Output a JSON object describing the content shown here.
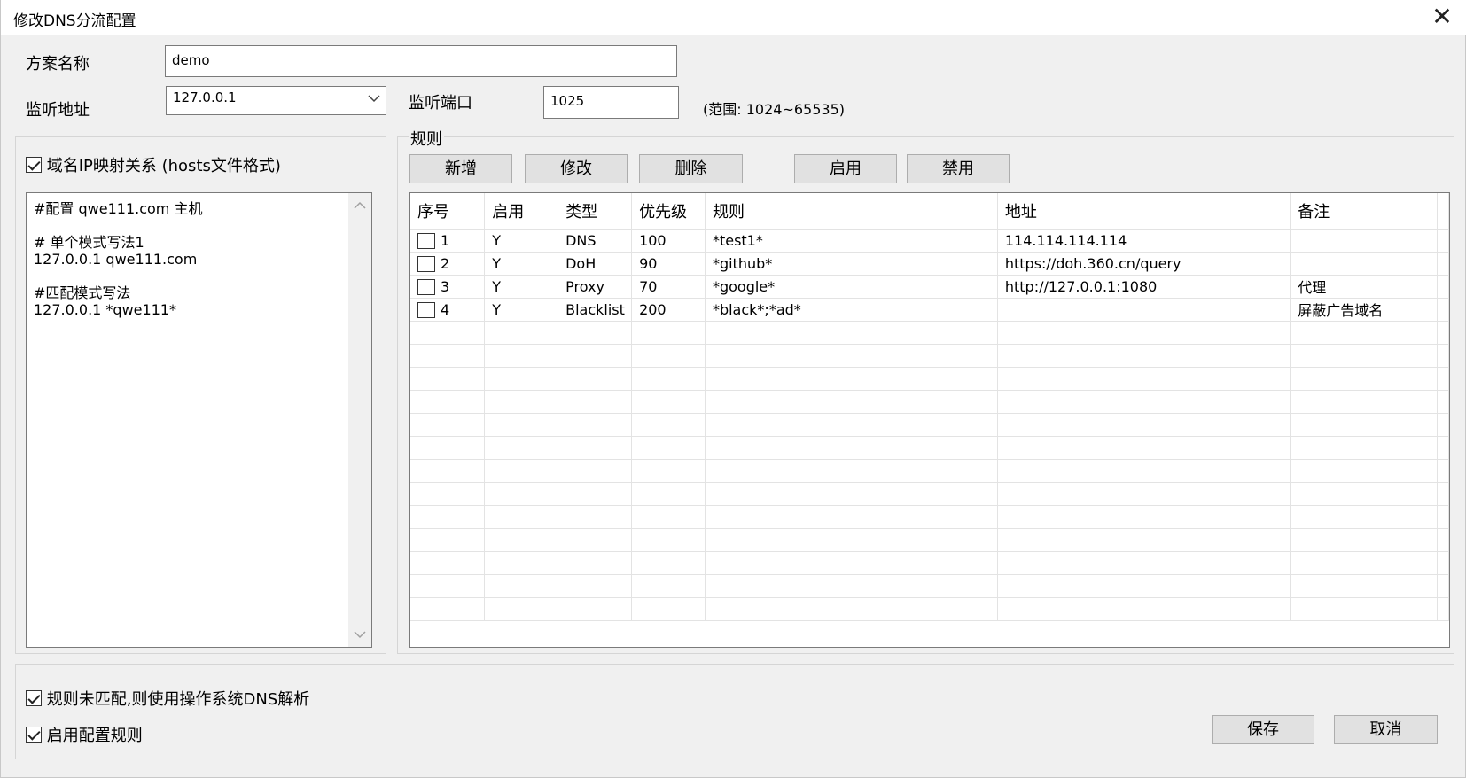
{
  "window": {
    "title": "修改DNS分流配置",
    "close_glyph": "✕"
  },
  "form": {
    "scheme_name_label": "方案名称",
    "scheme_name_value": "demo",
    "listen_addr_label": "监听地址",
    "listen_addr_value": "127.0.0.1",
    "listen_port_label": "监听端口",
    "listen_port_value": "1025",
    "port_range_hint": "(范围: 1024~65535)"
  },
  "hosts": {
    "enabled": true,
    "checkbox_label": "域名IP映射关系 (hosts文件格式)",
    "content": "#配置 qwe111.com 主机\n\n# 单个模式写法1\n127.0.0.1 qwe111.com\n\n#匹配模式写法\n127.0.0.1 *qwe111*"
  },
  "rules": {
    "group_label": "规则",
    "buttons": {
      "add": "新增",
      "edit": "修改",
      "delete": "删除",
      "enable": "启用",
      "disable": "禁用"
    },
    "columns": [
      "序号",
      "启用",
      "类型",
      "优先级",
      "规则",
      "地址",
      "备注"
    ],
    "rows": [
      {
        "seq": "1",
        "enabled": "Y",
        "type": "DNS",
        "priority": "100",
        "rule": "*test1*",
        "address": "114.114.114.114",
        "note": ""
      },
      {
        "seq": "2",
        "enabled": "Y",
        "type": "DoH",
        "priority": "90",
        "rule": "*github*",
        "address": "https://doh.360.cn/query",
        "note": ""
      },
      {
        "seq": "3",
        "enabled": "Y",
        "type": "Proxy",
        "priority": "70",
        "rule": "*google*",
        "address": "http://127.0.0.1:1080",
        "note": "代理"
      },
      {
        "seq": "4",
        "enabled": "Y",
        "type": "Blacklist",
        "priority": "200",
        "rule": "*black*;*ad*",
        "address": "",
        "note": "屏蔽广告域名"
      }
    ]
  },
  "footer": {
    "fallback_os_dns": {
      "checked": true,
      "label": "规则未匹配,则使用操作系统DNS解析"
    },
    "enable_rules": {
      "checked": true,
      "label": "启用配置规则"
    },
    "save_label": "保存",
    "cancel_label": "取消"
  }
}
